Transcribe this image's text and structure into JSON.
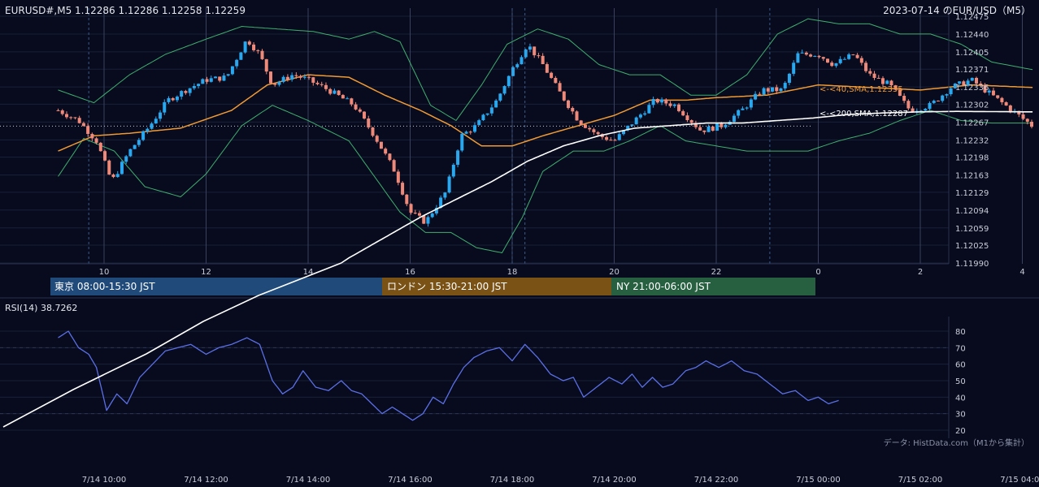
{
  "header": {
    "symbol_info": "EURUSD#,M5 1.12286 1.12286 1.12258 1.12259",
    "title_right": "2023-07-14 のEUR/USD（M5）"
  },
  "colors": {
    "background": "#070b1d",
    "bull_candle": "#29a8f0",
    "bear_candle": "#ef8a7a",
    "sma40": "#f09a35",
    "sma200": "#ffffff",
    "bollinger": "#3fae6f",
    "rsi": "#5b6fe6",
    "grid": "#1a2038"
  },
  "sessions": [
    {
      "label": "東京 08:00-15:30 JST",
      "color": "#204a7a"
    },
    {
      "label": "ロンドン 15:30-21:00 JST",
      "color": "#7a5216"
    },
    {
      "label": "NY 21:00-06:00 JST",
      "color": "#276040"
    }
  ],
  "indicators": {
    "sma40_label": "<-<40,SMA,1.12335",
    "sma200_label": "<-<200,SMA,1.12287",
    "rsi_label": "RSI(14) 38.7262"
  },
  "footer": {
    "source_note": "データ: HistData.com（M1から集計）"
  },
  "chart_data": [
    {
      "type": "candlestick",
      "title": "2023-07-14 のEUR/USD（M5）",
      "ylim": [
        1.1199,
        1.12475
      ],
      "y_ticks": [
        "1.12475",
        "1.12440",
        "1.12405",
        "1.12371",
        "1.12336",
        "1.12302",
        "1.12267",
        "1.12232",
        "1.12198",
        "1.12163",
        "1.12129",
        "1.12094",
        "1.12059",
        "1.12025",
        "1.11990"
      ],
      "x_ticks": [
        "10",
        "12",
        "14",
        "16",
        "18",
        "20",
        "22",
        "0",
        "2",
        "4"
      ],
      "bottom_time_ticks": [
        "7/14 10:00",
        "7/14 12:00",
        "7/14 14:00",
        "7/14 16:00",
        "7/14 18:00",
        "7/14 20:00",
        "7/14 22:00",
        "7/15 00:00",
        "7/15 02:00",
        "7/15 04:00"
      ],
      "x_range_hours": [
        9.1,
        5.2
      ],
      "close_anchors": [
        [
          9.1,
          1.1229
        ],
        [
          9.5,
          1.1227
        ],
        [
          9.85,
          1.1223
        ],
        [
          10.15,
          1.1215
        ],
        [
          10.5,
          1.1221
        ],
        [
          10.9,
          1.1226
        ],
        [
          11.25,
          1.1231
        ],
        [
          11.6,
          1.1233
        ],
        [
          12.0,
          1.1235
        ],
        [
          12.4,
          1.12355
        ],
        [
          12.8,
          1.1243
        ],
        [
          13.05,
          1.124
        ],
        [
          13.3,
          1.1234
        ],
        [
          13.7,
          1.1236
        ],
        [
          14.0,
          1.1235
        ],
        [
          14.4,
          1.1233
        ],
        [
          14.9,
          1.123
        ],
        [
          15.3,
          1.1224
        ],
        [
          15.7,
          1.1217
        ],
        [
          16.0,
          1.1209
        ],
        [
          16.3,
          1.1207
        ],
        [
          16.7,
          1.1213
        ],
        [
          17.0,
          1.1224
        ],
        [
          17.3,
          1.1226
        ],
        [
          17.7,
          1.1231
        ],
        [
          18.0,
          1.1237
        ],
        [
          18.3,
          1.1242
        ],
        [
          18.6,
          1.1238
        ],
        [
          18.9,
          1.1233
        ],
        [
          19.3,
          1.1227
        ],
        [
          19.7,
          1.1224
        ],
        [
          20.0,
          1.1223
        ],
        [
          20.4,
          1.1227
        ],
        [
          20.8,
          1.1231
        ],
        [
          21.2,
          1.123
        ],
        [
          21.7,
          1.1225
        ],
        [
          22.1,
          1.1226
        ],
        [
          22.5,
          1.1229
        ],
        [
          22.9,
          1.1233
        ],
        [
          23.3,
          1.1233
        ],
        [
          23.6,
          1.124
        ],
        [
          24.0,
          1.124
        ],
        [
          24.3,
          1.1238
        ],
        [
          24.7,
          1.124
        ],
        [
          25.0,
          1.1236
        ],
        [
          25.4,
          1.1234
        ],
        [
          25.8,
          1.1229
        ],
        [
          26.2,
          1.123
        ],
        [
          26.6,
          1.12335
        ],
        [
          27.0,
          1.1235
        ],
        [
          27.4,
          1.1232
        ],
        [
          27.8,
          1.1229
        ],
        [
          28.2,
          1.12259
        ]
      ],
      "series": [
        {
          "name": "SMA 40",
          "last": 1.12335
        },
        {
          "name": "SMA 200",
          "last": 1.12287
        }
      ],
      "sma40_anchors": [
        [
          9.1,
          1.1221
        ],
        [
          9.8,
          1.1224
        ],
        [
          10.5,
          1.12245
        ],
        [
          11.5,
          1.12255
        ],
        [
          12.5,
          1.1229
        ],
        [
          13.2,
          1.1234
        ],
        [
          14.0,
          1.1236
        ],
        [
          14.8,
          1.12355
        ],
        [
          15.5,
          1.1232
        ],
        [
          16.2,
          1.1229
        ],
        [
          16.8,
          1.1226
        ],
        [
          17.4,
          1.1222
        ],
        [
          18.0,
          1.1222
        ],
        [
          18.6,
          1.1224
        ],
        [
          19.3,
          1.1226
        ],
        [
          20.0,
          1.1228
        ],
        [
          20.7,
          1.1231
        ],
        [
          21.4,
          1.1231
        ],
        [
          22.0,
          1.12315
        ],
        [
          23.0,
          1.1232
        ],
        [
          24.0,
          1.1234
        ],
        [
          25.0,
          1.12335
        ],
        [
          26.0,
          1.1233
        ],
        [
          27.0,
          1.1234
        ],
        [
          28.2,
          1.12335
        ]
      ],
      "sma200_anchors": [
        [
          13.7,
          1.1185
        ],
        [
          14.2,
          1.1196
        ],
        [
          14.8,
          1.12
        ],
        [
          15.5,
          1.1204
        ],
        [
          16.2,
          1.1208
        ],
        [
          16.9,
          1.12115
        ],
        [
          17.6,
          1.1215
        ],
        [
          18.3,
          1.1219
        ],
        [
          19.0,
          1.1222
        ],
        [
          19.7,
          1.1224
        ],
        [
          20.4,
          1.12255
        ],
        [
          21.1,
          1.1226
        ],
        [
          21.8,
          1.12265
        ],
        [
          22.5,
          1.12265
        ],
        [
          23.2,
          1.1227
        ],
        [
          23.9,
          1.12275
        ],
        [
          24.6,
          1.12282
        ],
        [
          25.3,
          1.12285
        ],
        [
          26.0,
          1.12287
        ],
        [
          26.7,
          1.12288
        ],
        [
          28.2,
          1.12287
        ]
      ],
      "bb_upper_anchors": [
        [
          9.1,
          1.1233
        ],
        [
          9.8,
          1.12305
        ],
        [
          10.5,
          1.1236
        ],
        [
          11.2,
          1.124
        ],
        [
          12.0,
          1.1243
        ],
        [
          12.7,
          1.12455
        ],
        [
          13.4,
          1.1245
        ],
        [
          14.1,
          1.12445
        ],
        [
          14.8,
          1.1243
        ],
        [
          15.3,
          1.12445
        ],
        [
          15.8,
          1.12425
        ],
        [
          16.4,
          1.123
        ],
        [
          16.9,
          1.1227
        ],
        [
          17.4,
          1.1234
        ],
        [
          17.9,
          1.1242
        ],
        [
          18.5,
          1.1245
        ],
        [
          19.1,
          1.1243
        ],
        [
          19.7,
          1.1238
        ],
        [
          20.3,
          1.1236
        ],
        [
          20.9,
          1.1236
        ],
        [
          21.5,
          1.1232
        ],
        [
          22.0,
          1.1232
        ],
        [
          22.6,
          1.1236
        ],
        [
          23.2,
          1.1244
        ],
        [
          23.8,
          1.1247
        ],
        [
          24.4,
          1.1246
        ],
        [
          25.0,
          1.1246
        ],
        [
          25.6,
          1.1244
        ],
        [
          26.2,
          1.1244
        ],
        [
          26.8,
          1.1242
        ],
        [
          27.4,
          1.12385
        ],
        [
          28.2,
          1.1237
        ]
      ],
      "bb_lower_anchors": [
        [
          9.1,
          1.1216
        ],
        [
          9.6,
          1.12235
        ],
        [
          10.2,
          1.1221
        ],
        [
          10.8,
          1.1214
        ],
        [
          11.5,
          1.1212
        ],
        [
          12.0,
          1.12165
        ],
        [
          12.7,
          1.1226
        ],
        [
          13.3,
          1.123
        ],
        [
          14.0,
          1.1227
        ],
        [
          14.8,
          1.1223
        ],
        [
          15.3,
          1.1216
        ],
        [
          15.8,
          1.1209
        ],
        [
          16.3,
          1.1205
        ],
        [
          16.8,
          1.1205
        ],
        [
          17.3,
          1.1202
        ],
        [
          17.8,
          1.1201
        ],
        [
          18.2,
          1.1208
        ],
        [
          18.6,
          1.1217
        ],
        [
          19.2,
          1.1221
        ],
        [
          19.8,
          1.1221
        ],
        [
          20.3,
          1.1223
        ],
        [
          20.9,
          1.1226
        ],
        [
          21.4,
          1.1223
        ],
        [
          22.0,
          1.1222
        ],
        [
          22.6,
          1.1221
        ],
        [
          23.2,
          1.1221
        ],
        [
          23.8,
          1.1221
        ],
        [
          24.4,
          1.1223
        ],
        [
          25.0,
          1.12245
        ],
        [
          25.6,
          1.1227
        ],
        [
          26.2,
          1.1229
        ],
        [
          26.8,
          1.1227
        ],
        [
          27.4,
          1.12265
        ],
        [
          28.2,
          1.12265
        ]
      ]
    },
    {
      "type": "line",
      "title": "RSI(14) 38.7262",
      "ylim": [
        20,
        85
      ],
      "y_ticks": [
        "80",
        "70",
        "60",
        "50",
        "40",
        "30",
        "20"
      ],
      "last_value": 38.7262,
      "rsi_anchors": [
        [
          9.1,
          76
        ],
        [
          9.3,
          80
        ],
        [
          9.5,
          70
        ],
        [
          9.7,
          66
        ],
        [
          9.85,
          58
        ],
        [
          10.05,
          32
        ],
        [
          10.25,
          42
        ],
        [
          10.45,
          36
        ],
        [
          10.7,
          52
        ],
        [
          10.95,
          60
        ],
        [
          11.2,
          68
        ],
        [
          11.45,
          70
        ],
        [
          11.7,
          72
        ],
        [
          12.0,
          66
        ],
        [
          12.25,
          70
        ],
        [
          12.5,
          72
        ],
        [
          12.8,
          76
        ],
        [
          13.05,
          72
        ],
        [
          13.3,
          50
        ],
        [
          13.5,
          42
        ],
        [
          13.7,
          46
        ],
        [
          13.9,
          56
        ],
        [
          14.15,
          46
        ],
        [
          14.4,
          44
        ],
        [
          14.65,
          50
        ],
        [
          14.85,
          44
        ],
        [
          15.05,
          42
        ],
        [
          15.25,
          36
        ],
        [
          15.45,
          30
        ],
        [
          15.65,
          34
        ],
        [
          15.85,
          30
        ],
        [
          16.05,
          26
        ],
        [
          16.25,
          30
        ],
        [
          16.45,
          40
        ],
        [
          16.65,
          36
        ],
        [
          16.85,
          48
        ],
        [
          17.05,
          58
        ],
        [
          17.25,
          64
        ],
        [
          17.5,
          68
        ],
        [
          17.75,
          70
        ],
        [
          18.0,
          62
        ],
        [
          18.25,
          72
        ],
        [
          18.5,
          64
        ],
        [
          18.75,
          54
        ],
        [
          19.0,
          50
        ],
        [
          19.2,
          52
        ],
        [
          19.4,
          40
        ],
        [
          19.65,
          46
        ],
        [
          19.9,
          52
        ],
        [
          20.15,
          48
        ],
        [
          20.35,
          54
        ],
        [
          20.55,
          46
        ],
        [
          20.75,
          52
        ],
        [
          20.95,
          46
        ],
        [
          21.15,
          48
        ],
        [
          21.4,
          56
        ],
        [
          21.6,
          58
        ],
        [
          21.8,
          62
        ],
        [
          22.05,
          58
        ],
        [
          22.3,
          62
        ],
        [
          22.55,
          56
        ],
        [
          22.8,
          54
        ],
        [
          23.05,
          48
        ],
        [
          23.3,
          42
        ],
        [
          23.55,
          44
        ],
        [
          23.8,
          38
        ],
        [
          24.0,
          40
        ],
        [
          24.2,
          36
        ],
        [
          24.4,
          38
        ]
      ]
    }
  ]
}
